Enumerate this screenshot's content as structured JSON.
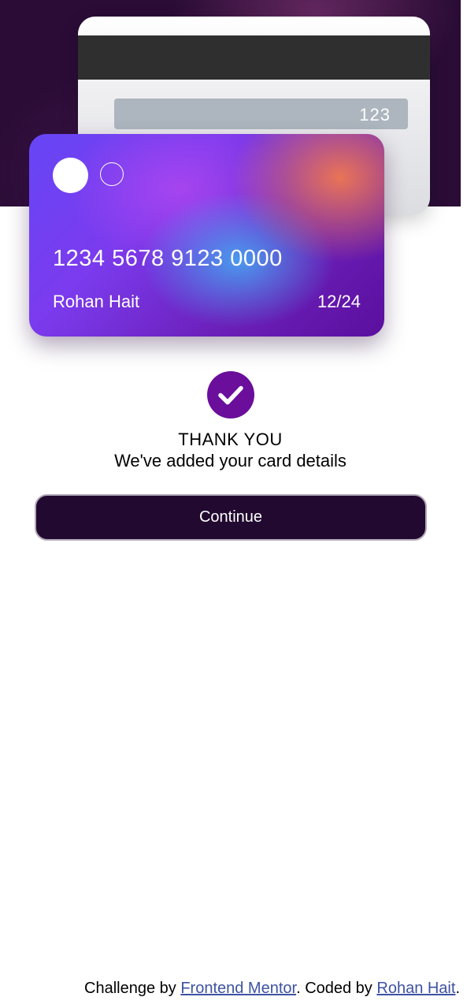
{
  "card": {
    "cvc": "123",
    "number": "1234 5678 9123 0000",
    "holder": "Rohan Hait",
    "expiry": "12/24"
  },
  "confirmation": {
    "icon": "check-icon",
    "title": "THANK YOU",
    "subtitle": "We've added your card details",
    "continue_label": "Continue"
  },
  "footer": {
    "prefix": "Challenge by ",
    "challenge_link": "Frontend Mentor",
    "middle": ". Coded by ",
    "author_link": "Rohan Hait",
    "suffix": "."
  },
  "colors": {
    "hero_background": "#2a0c36",
    "accent": "#6a0e9b",
    "button_background": "#220930",
    "link": "#3e52a3"
  }
}
